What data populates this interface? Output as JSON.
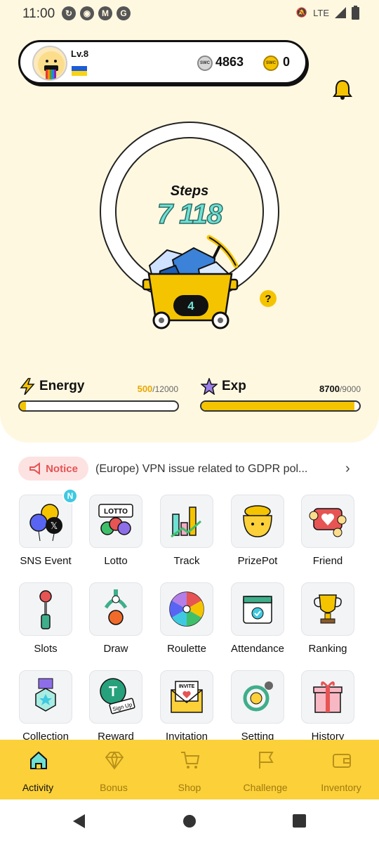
{
  "status_bar": {
    "time": "11:00",
    "network": "LTE"
  },
  "profile": {
    "level": "Lv.8"
  },
  "wallet": {
    "coin1_label": "SWC",
    "coin1_value": "4863",
    "coin2_label": "SWC",
    "coin2_value": "0"
  },
  "steps": {
    "label": "Steps",
    "value": "7 118"
  },
  "cart": {
    "count": "4"
  },
  "help_label": "?",
  "energy": {
    "label": "Energy",
    "current": "500",
    "max": "/12000",
    "fraction": 0.0417
  },
  "exp": {
    "label": "Exp",
    "current": "8700",
    "max": "/9000",
    "fraction": 0.9667
  },
  "notice": {
    "label": "Notice",
    "text": "(Europe) VPN issue related to GDPR pol..."
  },
  "badge_new": "N",
  "grid": [
    "SNS Event",
    "Lotto",
    "Track",
    "PrizePot",
    "Friend",
    "Slots",
    "Draw",
    "Roulette",
    "Attendance",
    "Ranking",
    "Collection",
    "Reward",
    "Invitation",
    "Setting",
    "History"
  ],
  "icon_text": {
    "lotto": "LOTTO",
    "invite": "INVITE",
    "signup": "Sign Up"
  },
  "tabs": [
    "Activity",
    "Bonus",
    "Shop",
    "Challenge",
    "Inventory"
  ],
  "colors": {
    "accent": "#fbd039",
    "panel": "#fff8e1",
    "steps": "#6fe0d4",
    "notice": "#e65454"
  }
}
